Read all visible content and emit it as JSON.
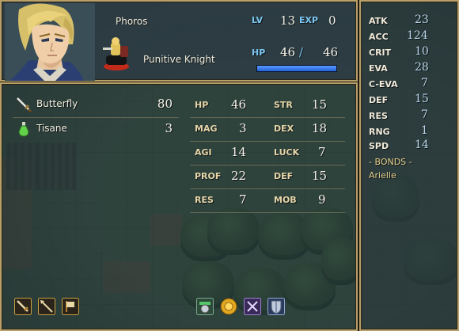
{
  "unit": {
    "name": "Phoros",
    "class": "Punitive Knight",
    "level_label": "LV",
    "level": "13",
    "exp_label": "EXP",
    "exp": "0",
    "hp_label": "HP",
    "hp_current": "46",
    "hp_sep": "/",
    "hp_max": "46",
    "hp_fraction": 1.0
  },
  "inventory": [
    {
      "name": "Butterfly",
      "value": "80",
      "icon": "sword-icon"
    },
    {
      "name": "Tisane",
      "value": "3",
      "icon": "potion-icon"
    }
  ],
  "stats_left": [
    {
      "label": "HP",
      "value": "46"
    },
    {
      "label": "MAG",
      "value": "3"
    },
    {
      "label": "AGI",
      "value": "14"
    },
    {
      "label": "PROF",
      "value": "22"
    },
    {
      "label": "RES",
      "value": "7"
    }
  ],
  "stats_right": [
    {
      "label": "STR",
      "value": "15"
    },
    {
      "label": "DEX",
      "value": "18"
    },
    {
      "label": "LUCK",
      "value": "7"
    },
    {
      "label": "DEF",
      "value": "15"
    },
    {
      "label": "MOB",
      "value": "9"
    }
  ],
  "combat_stats": [
    {
      "label": "ATK",
      "value": "23"
    },
    {
      "label": "ACC",
      "value": "124"
    },
    {
      "label": "CRIT",
      "value": "10"
    },
    {
      "label": "EVA",
      "value": "28"
    },
    {
      "label": "C-EVA",
      "value": "7"
    },
    {
      "label": "DEF",
      "value": "15"
    },
    {
      "label": "RES",
      "value": "7"
    },
    {
      "label": "RNG",
      "value": "1"
    },
    {
      "label": "SPD",
      "value": "14"
    }
  ],
  "bonds": {
    "header": "- BONDS -",
    "names": [
      "Arielle"
    ]
  },
  "weapon_ranks": [
    "sword-rank-icon",
    "lance-rank-icon",
    "axe-rank-icon"
  ],
  "skills": [
    "gear-skill-icon",
    "sun-medal-skill-icon",
    "rune-skill-icon",
    "shield-skill-icon"
  ],
  "colors": {
    "frame": "#b8a069",
    "hp_bar": "#2f78ee",
    "blue_label": "#7cc6f2"
  }
}
